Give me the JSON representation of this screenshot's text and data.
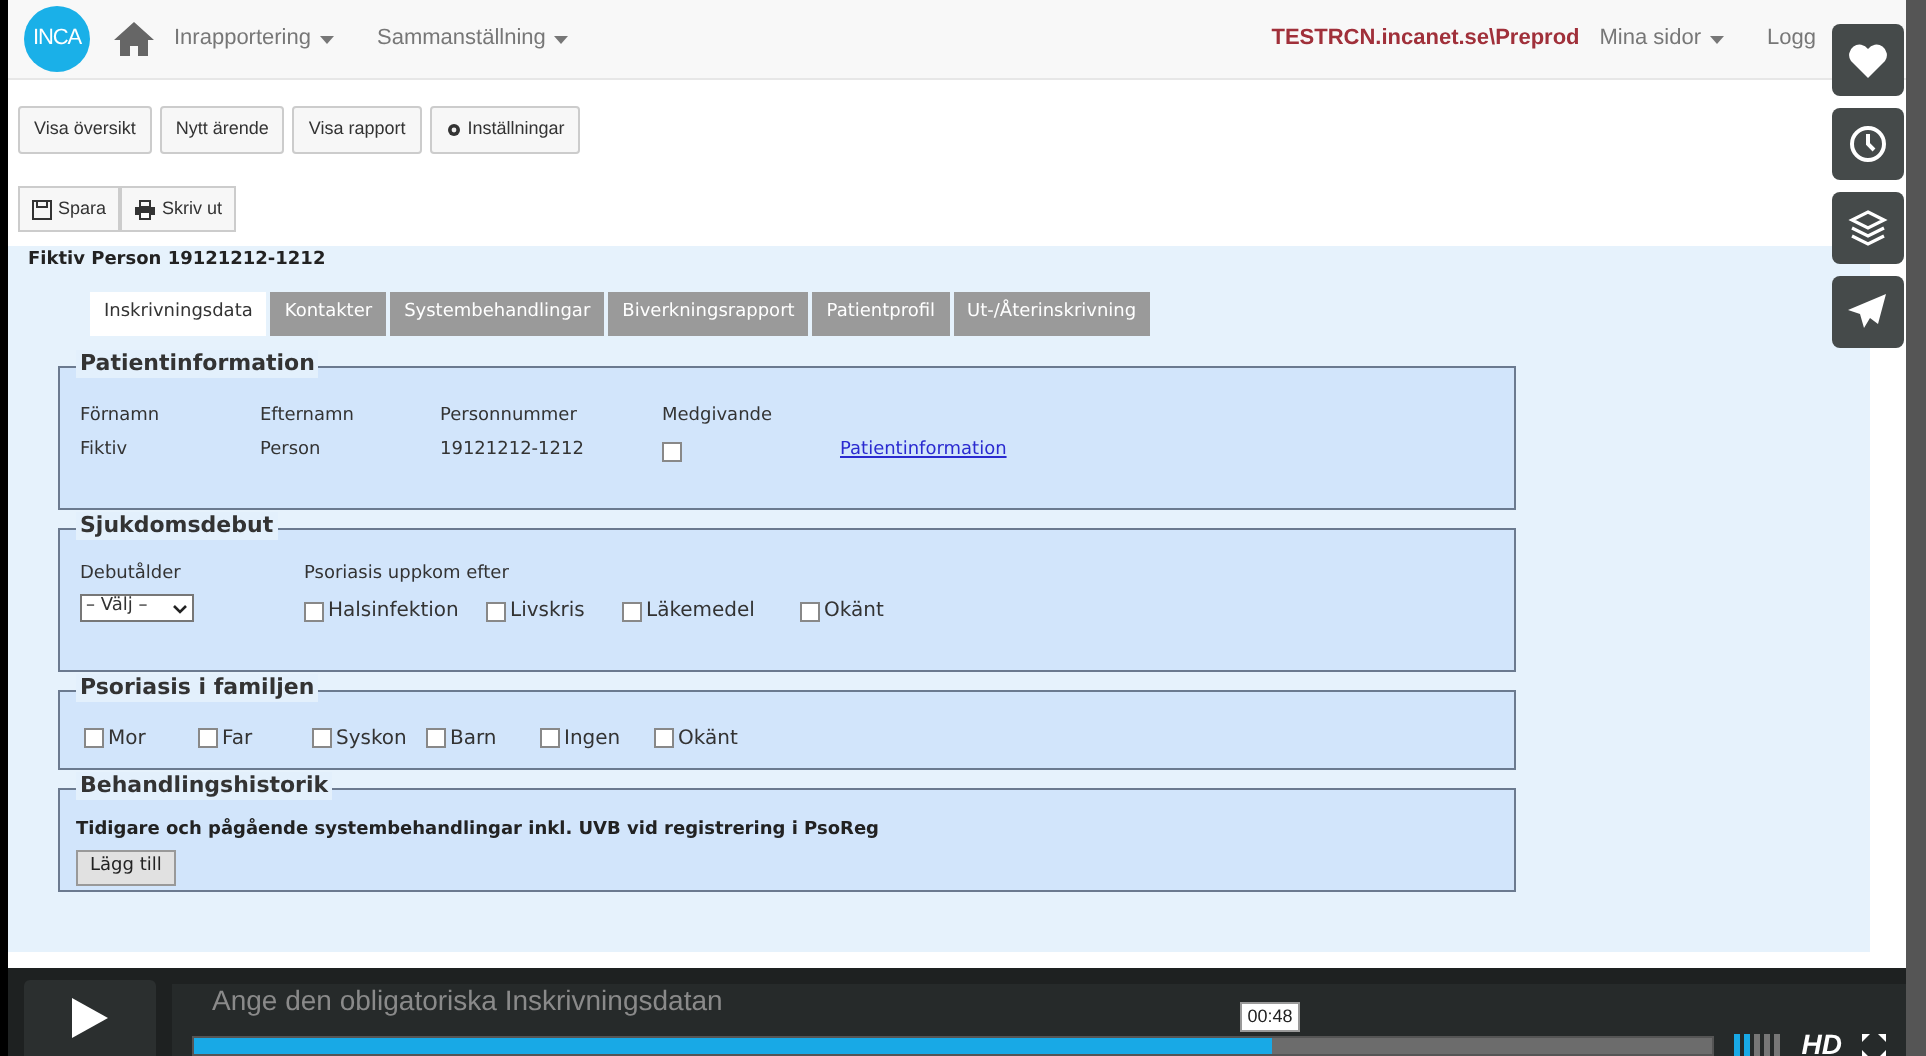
{
  "navbar": {
    "logo": "INCA",
    "menus": [
      {
        "label": "Inrapportering"
      },
      {
        "label": "Sammanställning"
      }
    ],
    "environment": "TESTRCN.incanet.se\\Preprod",
    "user_menu": "Mina sidor",
    "logout": "Logg"
  },
  "toolbar": [
    {
      "label": "Visa översikt",
      "kind": "plain"
    },
    {
      "label": "Nytt ärende",
      "kind": "plain"
    },
    {
      "label": "Visa rapport",
      "kind": "plain"
    },
    {
      "label": "Inställningar",
      "kind": "settings"
    }
  ],
  "actions": [
    {
      "label": "Spara",
      "kind": "save"
    },
    {
      "label": "Skriv ut",
      "kind": "print"
    }
  ],
  "patient_title": "Fiktiv Person 19121212-1212",
  "tabs": [
    {
      "label": "Inskrivningsdata",
      "selected": true
    },
    {
      "label": "Kontakter",
      "selected": false
    },
    {
      "label": "Systembehandlingar",
      "selected": false
    },
    {
      "label": "Biverkningsrapport",
      "selected": false
    },
    {
      "label": "Patientprofil",
      "selected": false
    },
    {
      "label": "Ut-/Återinskrivning",
      "selected": false
    }
  ],
  "patientinformation": {
    "legend": "Patientinformation",
    "columns": [
      "Förnamn",
      "Efternamn",
      "Personnummer",
      "Medgivande"
    ],
    "values": [
      "Fiktiv",
      "Person",
      "19121212-1212"
    ],
    "consent_checked": false,
    "link": "Patientinformation"
  },
  "sjukdomsdebut": {
    "legend": "Sjukdomsdebut",
    "age_label": "Debutålder",
    "age_select": "– Välj –",
    "trigger_label": "Psoriasis uppkom efter",
    "options": [
      {
        "label": "Halsinfektion",
        "checked": false
      },
      {
        "label": "Livskris",
        "checked": false
      },
      {
        "label": "Läkemedel",
        "checked": false
      },
      {
        "label": "Okänt",
        "checked": false
      }
    ]
  },
  "familj": {
    "legend": "Psoriasis i familjen",
    "options": [
      {
        "label": "Mor",
        "checked": false
      },
      {
        "label": "Far",
        "checked": false
      },
      {
        "label": "Syskon",
        "checked": false
      },
      {
        "label": "Barn",
        "checked": false
      },
      {
        "label": "Ingen",
        "checked": false
      },
      {
        "label": "Okänt",
        "checked": false
      }
    ]
  },
  "behandlingshistorik": {
    "legend": "Behandlingshistorik",
    "text": "Tidigare och pågående systembehandlingar inkl. UVB vid registrering i PsoReg",
    "button": "Lägg till"
  },
  "player": {
    "caption": "Ange den obligatoriska Inskrivningsdatan",
    "time": "00:48",
    "level": 0.71,
    "quality": "HD"
  }
}
